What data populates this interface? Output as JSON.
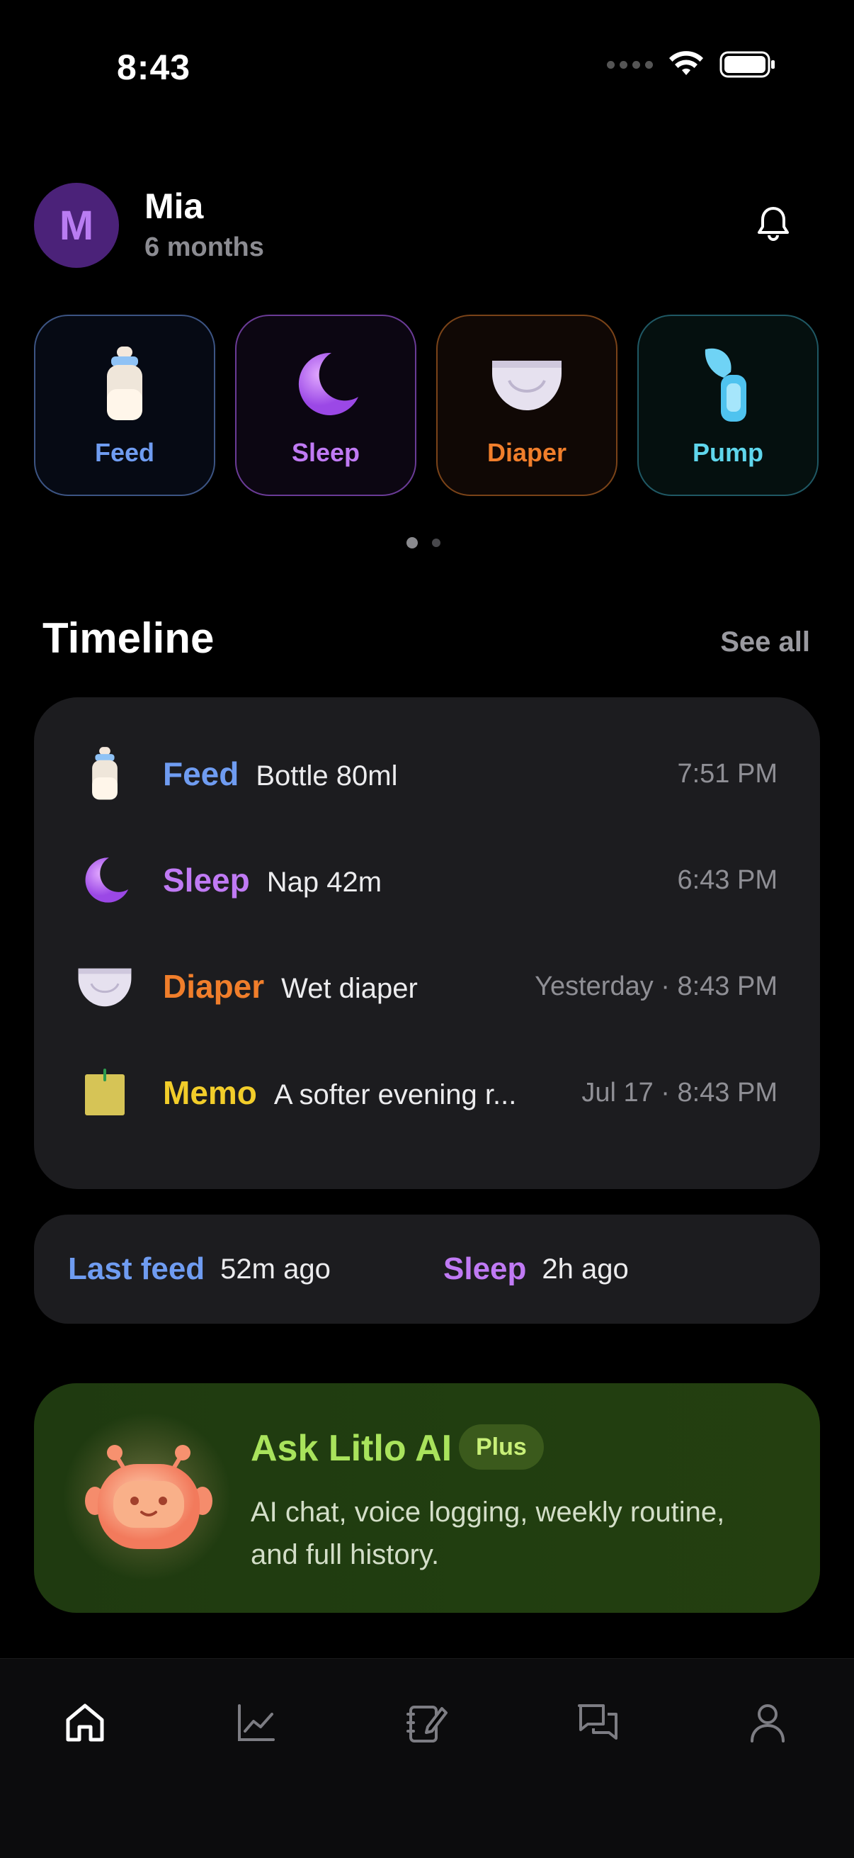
{
  "status_bar": {
    "time": "8:43"
  },
  "header": {
    "avatar_initial": "M",
    "child_name": "Mia",
    "child_age": "6 months"
  },
  "quick_actions": [
    {
      "label": "Feed",
      "icon": "bottle-icon"
    },
    {
      "label": "Sleep",
      "icon": "moon-icon"
    },
    {
      "label": "Diaper",
      "icon": "diaper-icon"
    },
    {
      "label": "Pump",
      "icon": "breast-pump-icon"
    }
  ],
  "pager": {
    "pages": 2,
    "current": 1
  },
  "timeline": {
    "title": "Timeline",
    "see_all": "See all",
    "entries": [
      {
        "type": "Feed",
        "detail": "Bottle 80ml",
        "time": "7:51 PM",
        "icon": "bottle-icon"
      },
      {
        "type": "Sleep",
        "detail": "Nap 42m",
        "time": "6:43 PM",
        "icon": "moon-icon"
      },
      {
        "type": "Diaper",
        "detail": "Wet diaper",
        "time": "Yesterday · 8:43 PM",
        "icon": "diaper-icon"
      },
      {
        "type": "Memo",
        "detail": "A softer evening r...",
        "time": "Jul 17 · 8:43 PM",
        "icon": "memo-note-icon"
      }
    ]
  },
  "summary": {
    "last_feed_label": "Last feed",
    "last_feed_value": "52m ago",
    "sleep_label": "Sleep",
    "sleep_value": "2h ago"
  },
  "promo": {
    "title": "Ask Litlo AI",
    "badge": "Plus",
    "description": "AI chat, voice logging, weekly routine, and full history."
  },
  "tabs": [
    {
      "name": "home",
      "icon": "home-icon",
      "active": true
    },
    {
      "name": "stats",
      "icon": "chart-icon",
      "active": false
    },
    {
      "name": "journal",
      "icon": "notebook-edit-icon",
      "active": false
    },
    {
      "name": "chat",
      "icon": "chat-icon",
      "active": false
    },
    {
      "name": "profile",
      "icon": "profile-icon",
      "active": false
    }
  ],
  "colors": {
    "feed": "#6f9cf1",
    "sleep": "#c07af4",
    "diaper": "#f07e2b",
    "pump": "#5fd6ec",
    "memo": "#f2cd2a",
    "ai": "#a9e35c"
  }
}
